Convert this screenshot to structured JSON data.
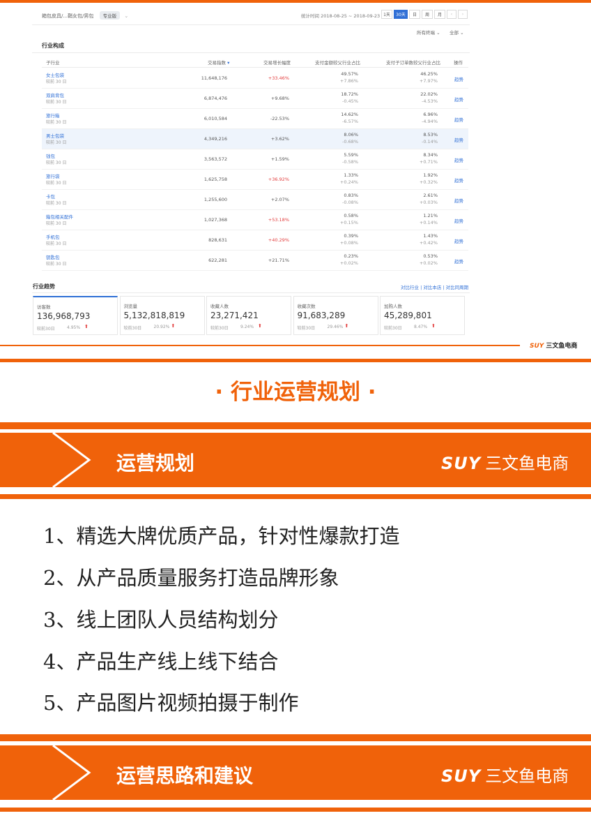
{
  "top": {
    "breadcrumb": "箱包皮具/...鞘女包/男包",
    "badge": "专业版",
    "stat_time": "统计时间 2018-08-25 ~ 2018-09-23",
    "ranges": [
      "1天",
      "30天",
      "日",
      "周",
      "月"
    ],
    "active_range": "30天",
    "filter_terminal": "所有终端",
    "filter_all": "全部"
  },
  "industry": {
    "title": "行业构成",
    "headers": [
      "子行业",
      "交易指数",
      "交易增长幅度",
      "支付金额较父行业占比",
      "支付子订单数较父行业占比",
      "操作"
    ],
    "rows": [
      {
        "name": "女士包袋",
        "sub": "较前 30 日",
        "index": "11,648,176",
        "growth": "+33.46%",
        "growth_red": true,
        "amt": "49.57%",
        "amt_chg": "+7.86%",
        "ord": "46.25%",
        "ord_chg": "+7.97%",
        "action": "趋势"
      },
      {
        "name": "双肩背包",
        "sub": "较前 30 日",
        "index": "6,874,476",
        "growth": "+9.68%",
        "growth_red": false,
        "amt": "18.72%",
        "amt_chg": "-0.45%",
        "ord": "22.02%",
        "ord_chg": "-4.53%",
        "action": "趋势"
      },
      {
        "name": "旅行箱",
        "sub": "较前 30 日",
        "index": "6,010,584",
        "growth": "-22.53%",
        "growth_red": false,
        "amt": "14.62%",
        "amt_chg": "-6.57%",
        "ord": "6.96%",
        "ord_chg": "-4.94%",
        "action": "趋势"
      },
      {
        "name": "男士包袋",
        "sub": "较前 30 日",
        "index": "4,349,216",
        "growth": "+3.62%",
        "growth_red": false,
        "amt": "8.06%",
        "amt_chg": "-0.68%",
        "ord": "8.53%",
        "ord_chg": "-0.14%",
        "action": "趋势"
      },
      {
        "name": "钱包",
        "sub": "较前 30 日",
        "index": "3,563,572",
        "growth": "+1.59%",
        "growth_red": false,
        "amt": "5.59%",
        "amt_chg": "-0.58%",
        "ord": "8.34%",
        "ord_chg": "+0.71%",
        "action": "趋势"
      },
      {
        "name": "旅行袋",
        "sub": "较前 30 日",
        "index": "1,625,758",
        "growth": "+36.92%",
        "growth_red": true,
        "amt": "1.33%",
        "amt_chg": "+0.24%",
        "ord": "1.92%",
        "ord_chg": "+0.32%",
        "action": "趋势"
      },
      {
        "name": "卡包",
        "sub": "较前 30 日",
        "index": "1,255,600",
        "growth": "+2.07%",
        "growth_red": false,
        "amt": "0.83%",
        "amt_chg": "-0.08%",
        "ord": "2.61%",
        "ord_chg": "+0.03%",
        "action": "趋势"
      },
      {
        "name": "箱包相关配件",
        "sub": "较前 30 日",
        "index": "1,027,368",
        "growth": "+53.18%",
        "growth_red": true,
        "amt": "0.58%",
        "amt_chg": "+0.15%",
        "ord": "1.21%",
        "ord_chg": "+0.14%",
        "action": "趋势"
      },
      {
        "name": "手机包",
        "sub": "较前 30 日",
        "index": "828,631",
        "growth": "+40.29%",
        "growth_red": true,
        "amt": "0.39%",
        "amt_chg": "+0.08%",
        "ord": "1.43%",
        "ord_chg": "+0.42%",
        "action": "趋势"
      },
      {
        "name": "钥匙包",
        "sub": "较前 30 日",
        "index": "622,281",
        "growth": "+21.71%",
        "growth_red": false,
        "amt": "0.23%",
        "amt_chg": "+0.02%",
        "ord": "0.53%",
        "ord_chg": "+0.02%",
        "action": "趋势"
      }
    ]
  },
  "trend": {
    "title": "行业趋势",
    "links": "对比行业 | 对比本店 | 对比同周期",
    "cards": [
      {
        "label": "访客数",
        "value": "136,968,793",
        "cmp": "较前30日",
        "pct": "4.95%"
      },
      {
        "label": "浏览量",
        "value": "5,132,818,819",
        "cmp": "较前30日",
        "pct": "20.92%"
      },
      {
        "label": "收藏人数",
        "value": "23,271,421",
        "cmp": "较前30日",
        "pct": "9.24%"
      },
      {
        "label": "收藏次数",
        "value": "91,683,289",
        "cmp": "较前30日",
        "pct": "29.46%"
      },
      {
        "label": "加购人数",
        "value": "45,289,801",
        "cmp": "较前30日",
        "pct": "8.47%"
      }
    ]
  },
  "brand": {
    "suy": "SUY",
    "name": "三文鱼电商"
  },
  "heading": "· 行业运营规划 ·",
  "banner1": {
    "title": "运营规划"
  },
  "plan_items": [
    "1、精选大牌优质产品，针对性爆款打造",
    "2、从产品质量服务打造品牌形象",
    "3、线上团队人员结构划分",
    "4、产品生产线上线下结合",
    "5、产品图片视频拍摄于制作"
  ],
  "banner2": {
    "title": "运营思路和建议"
  },
  "colors": {
    "accent": "#f0620a",
    "link": "#2f6fd6",
    "up": "#e23c3c"
  }
}
